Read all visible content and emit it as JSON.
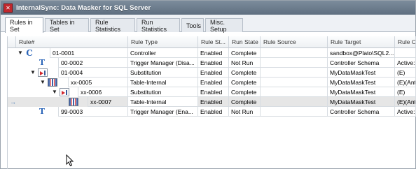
{
  "window": {
    "title": "InternalSync: Data Masker for SQL Server",
    "icon": "app-icon"
  },
  "tabs": [
    {
      "label": "Rules in Set",
      "active": true
    },
    {
      "label": "Tables in Set",
      "active": false
    },
    {
      "label": "Rule Statistics",
      "active": false
    },
    {
      "label": "Run Statistics",
      "active": false
    },
    {
      "label": "Tools",
      "active": false
    },
    {
      "label": "Misc. Setup",
      "active": false
    }
  ],
  "grid": {
    "columns": [
      "Rule#",
      "Rule Type",
      "Rule St...",
      "Run State",
      "Rule Source",
      "Rule Target",
      "Rule Op"
    ],
    "rows": [
      {
        "expander": "▼",
        "icon": "controller-icon",
        "rule": "01-0001",
        "type": "Controller",
        "status": "Enabled",
        "run_state": "Complete",
        "source": "",
        "target": "sandbox@Plato\\SQL2...",
        "op": ""
      },
      {
        "expander": "",
        "icon": "trigger-manager-icon",
        "rule": "00-0002",
        "type": "Trigger Manager (Disa...",
        "status": "Enabled",
        "run_state": "Not Run",
        "source": "",
        "target": "Controller Schema",
        "op": "Active:"
      },
      {
        "expander": "▼",
        "icon": "substitution-icon",
        "rule": "01-0004",
        "type": "Substitution",
        "status": "Enabled",
        "run_state": "Complete",
        "source": "",
        "target": "MyDataMaskTest",
        "op": "(E)"
      },
      {
        "expander": "▼",
        "icon": "table-internal-icon",
        "rule": "xx-0005",
        "type": "Table-Internal",
        "status": "Enabled",
        "run_state": "Complete",
        "source": "",
        "target": "MyDataMaskTest",
        "op": "(E)(Ant"
      },
      {
        "expander": "▼",
        "icon": "substitution-icon",
        "rule": "xx-0006",
        "type": "Substitution",
        "status": "Enabled",
        "run_state": "Complete",
        "source": "",
        "target": "MyDataMaskTest",
        "op": "(E)"
      },
      {
        "expander": "",
        "icon": "table-internal-icon",
        "rule": "xx-0007",
        "type": "Table-Internal",
        "status": "Enabled",
        "run_state": "Complete",
        "source": "",
        "target": "MyDataMaskTest",
        "op": "(E)(Ant",
        "current": true
      },
      {
        "expander": "",
        "icon": "trigger-manager-icon",
        "rule": "99-0003",
        "type": "Trigger Manager (Ena...",
        "status": "Enabled",
        "run_state": "Not Run",
        "source": "",
        "target": "Controller Schema",
        "op": "Active:"
      }
    ]
  },
  "colors": {
    "titlebar": "#6b7b8c",
    "selected_row": "#e6e6e6",
    "icon_blue": "#2a64b8",
    "icon_red": "#d2262e"
  }
}
